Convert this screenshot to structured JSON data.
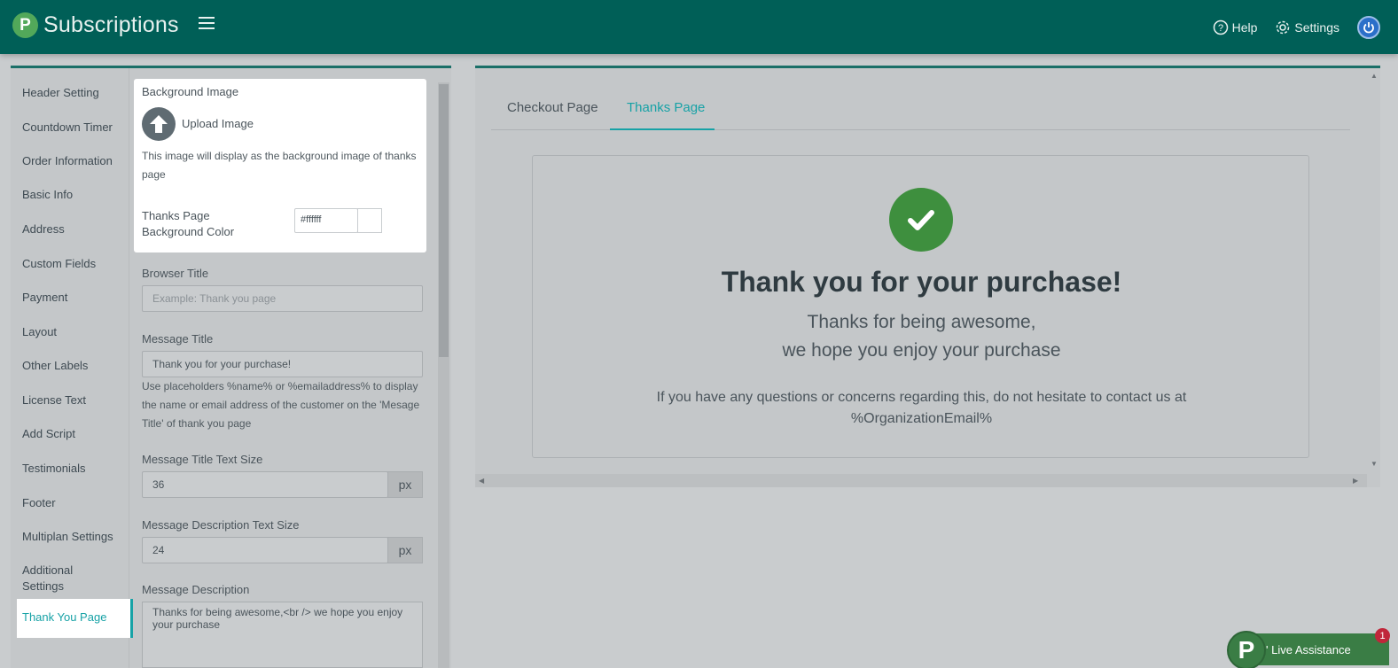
{
  "header": {
    "logo_letter": "P",
    "title": "Subscriptions",
    "help_label": "Help",
    "settings_label": "Settings"
  },
  "sidebar": {
    "items": [
      {
        "label": "Header Setting"
      },
      {
        "label": "Countdown Timer"
      },
      {
        "label": "Order Information"
      },
      {
        "label": "Basic Info"
      },
      {
        "label": "Address"
      },
      {
        "label": "Custom Fields"
      },
      {
        "label": "Payment"
      },
      {
        "label": "Layout"
      },
      {
        "label": "Other Labels"
      },
      {
        "label": "License Text"
      },
      {
        "label": "Add Script"
      },
      {
        "label": "Testimonials"
      },
      {
        "label": "Footer"
      },
      {
        "label": "Multiplan Settings"
      },
      {
        "label": "Additional Settings"
      },
      {
        "label": "Thank You Page"
      }
    ],
    "active": "Thank You Page"
  },
  "form": {
    "bg_image_label": "Background Image",
    "upload_label": "Upload Image",
    "bg_image_help": "This image will display as the background image of thanks page",
    "bg_color_label": "Thanks Page Background Color",
    "bg_color_value": "#ffffff",
    "browser_title_label": "Browser Title",
    "browser_title_placeholder": "Example: Thank you page",
    "message_title_label": "Message Title",
    "message_title_value": "Thank you for your purchase!",
    "message_title_help": "Use placeholders %name% or %emailaddress% to display the name or email address of the customer on the 'Mesage Title' of thank you page",
    "title_size_label": "Message Title Text Size",
    "title_size_value": "36",
    "desc_size_label": "Message Description Text Size",
    "desc_size_value": "24",
    "unit": "px",
    "message_desc_label": "Message Description",
    "message_desc_value": "Thanks for being awesome,<br /> we hope you enjoy your purchase"
  },
  "preview": {
    "tabs": [
      {
        "label": "Checkout Page"
      },
      {
        "label": "Thanks Page"
      }
    ],
    "active_tab": "Thanks Page",
    "title": "Thank you for your purchase!",
    "desc_line1": "Thanks for being awesome,",
    "desc_line2": "we hope you enjoy your purchase",
    "note_line1": "If you have any questions or concerns regarding this, do not hesitate to contact us at",
    "note_line2": "%OrganizationEmail%"
  },
  "live_chat": {
    "logo_letter": "P",
    "label": "' Live Assistance",
    "badge": "1"
  },
  "colors": {
    "header_bg": "#005f57",
    "accent": "#17a2a6",
    "success": "#3e8f3e",
    "badge": "#c0263a"
  }
}
